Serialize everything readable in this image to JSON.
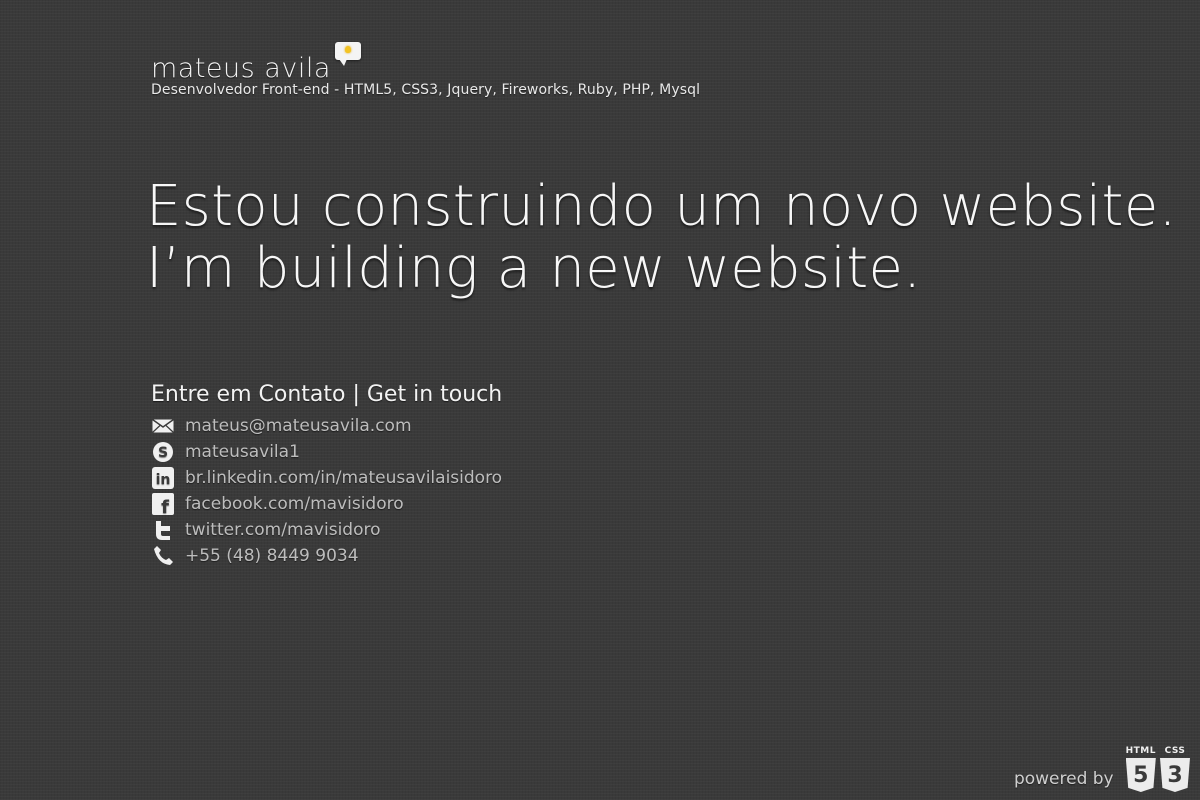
{
  "header": {
    "name": "mateus avila",
    "tagline": "Desenvolvedor Front-end - HTML5, CSS3, Jquery, Fireworks, Ruby, PHP, Mysql"
  },
  "headline": {
    "line1": "Estou construindo um novo website.",
    "line2": "I’m building a new website."
  },
  "contact": {
    "title": "Entre em Contato | Get in touch",
    "items": [
      {
        "icon": "mail-icon",
        "text": "mateus@mateusavila.com"
      },
      {
        "icon": "skype-icon",
        "text": "mateusavila1"
      },
      {
        "icon": "linkedin-icon",
        "text": "br.linkedin.com/in/mateusavilaisidoro"
      },
      {
        "icon": "facebook-icon",
        "text": "facebook.com/mavisidoro"
      },
      {
        "icon": "twitter-icon",
        "text": "twitter.com/mavisidoro"
      },
      {
        "icon": "phone-icon",
        "text": "+55 (48) 8449 9034"
      }
    ]
  },
  "footer": {
    "powered_by": "powered by",
    "html_label": "HTML",
    "html_number": "5",
    "css_label": "CSS",
    "css_number": "3"
  },
  "colors": {
    "background": "#3a3a3a",
    "text": "#f0f0f0",
    "link": "#bdbdbd",
    "bulb": "#f3c323"
  }
}
